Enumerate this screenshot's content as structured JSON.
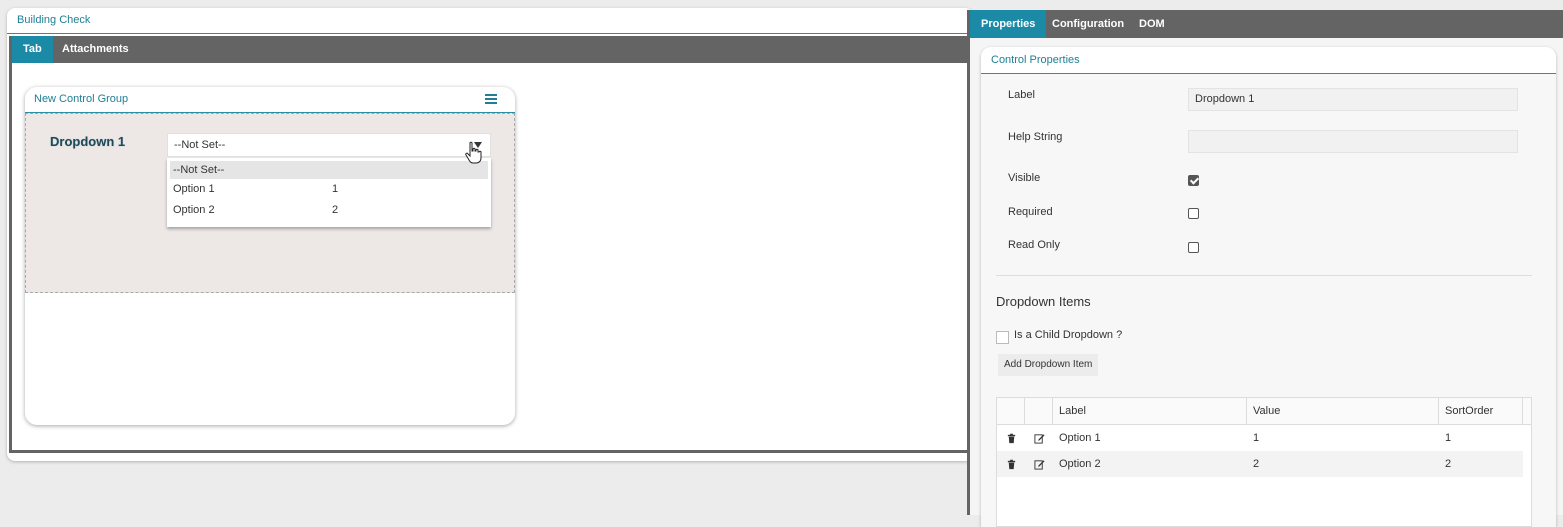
{
  "designer": {
    "title": "Building Check",
    "tabs": [
      {
        "label": "Tab",
        "active": true
      },
      {
        "label": "Attachments",
        "active": false
      }
    ],
    "group": {
      "title": "New Control Group",
      "menu_icon": "hamburger-menu-icon",
      "dropdown": {
        "label": "Dropdown 1",
        "selected": "--Not Set--",
        "options": [
          {
            "label": "--Not Set--",
            "value": ""
          },
          {
            "label": "Option 1",
            "value": "1"
          },
          {
            "label": "Option 2",
            "value": "2"
          }
        ]
      }
    }
  },
  "panel": {
    "tabs": [
      {
        "label": "Properties",
        "active": true
      },
      {
        "label": "Configuration",
        "active": false
      },
      {
        "label": "DOM",
        "active": false
      }
    ],
    "card_title": "Control Properties",
    "fields": {
      "label": {
        "caption": "Label",
        "value": "Dropdown 1"
      },
      "help": {
        "caption": "Help String",
        "value": ""
      },
      "visible": {
        "caption": "Visible",
        "checked": true
      },
      "required": {
        "caption": "Required",
        "checked": false
      },
      "read_only": {
        "caption": "Read Only",
        "checked": false
      }
    },
    "dropdown_items": {
      "title": "Dropdown Items",
      "child_label": "Is a Child Dropdown ?",
      "child_checked": false,
      "add_button": "Add Dropdown Item",
      "columns": [
        "Label",
        "Value",
        "SortOrder"
      ],
      "rows": [
        {
          "label": "Option 1",
          "value": "1",
          "sort": "1"
        },
        {
          "label": "Option 2",
          "value": "2",
          "sort": "2"
        }
      ]
    }
  },
  "colors": {
    "accent": "#1a8aa6",
    "tabbar": "#646464",
    "group_bg": "#ede7e6"
  }
}
